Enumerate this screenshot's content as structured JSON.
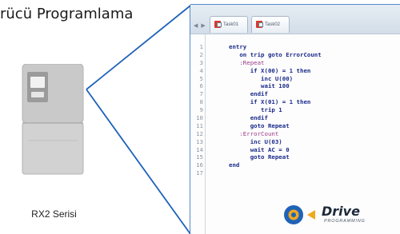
{
  "page": {
    "title": "rücü Programlama"
  },
  "device": {
    "label": "RX2 Serisi"
  },
  "editor": {
    "tabs": [
      {
        "label": "Task01",
        "state": "active"
      },
      {
        "label": "Task02",
        "state": "inactive"
      }
    ],
    "tab_nav_glyphs": "◀ ▶",
    "lines": [
      {
        "num": "1",
        "code": "entry"
      },
      {
        "num": "2",
        "code": "   on trip goto ErrorCount"
      },
      {
        "num": "3",
        "code": "   :Repeat",
        "kind": "label"
      },
      {
        "num": "4",
        "code": "      if X(00) = 1 then"
      },
      {
        "num": "5",
        "code": "         inc U(00)"
      },
      {
        "num": "6",
        "code": "         wait 100"
      },
      {
        "num": "7",
        "code": "      endif"
      },
      {
        "num": "8",
        "code": "      if X(01) = 1 then"
      },
      {
        "num": "9",
        "code": "         trip 1"
      },
      {
        "num": "10",
        "code": "      endif"
      },
      {
        "num": "11",
        "code": "      goto Repeat"
      },
      {
        "num": "12",
        "code": "   :ErrorCount",
        "kind": "label"
      },
      {
        "num": "13",
        "code": "      inc U(03)"
      },
      {
        "num": "14",
        "code": "      wait AC = 0"
      },
      {
        "num": "15",
        "code": "      goto Repeat"
      },
      {
        "num": "16",
        "code": "end"
      },
      {
        "num": "17",
        "code": ""
      }
    ]
  },
  "logo": {
    "word": "Drive",
    "subtitle": "PROGRAMMING",
    "icon": "drive-programming-logo-icon"
  },
  "colors": {
    "callout_line": "#1f63b8",
    "device_body": "#c9c9c9",
    "device_panel": "#dddddd",
    "keyword_blue": "#1a2a8a",
    "label_purple": "#9a3a8a",
    "logo_blue": "#1f63b8",
    "logo_gold": "#f0a81e"
  }
}
